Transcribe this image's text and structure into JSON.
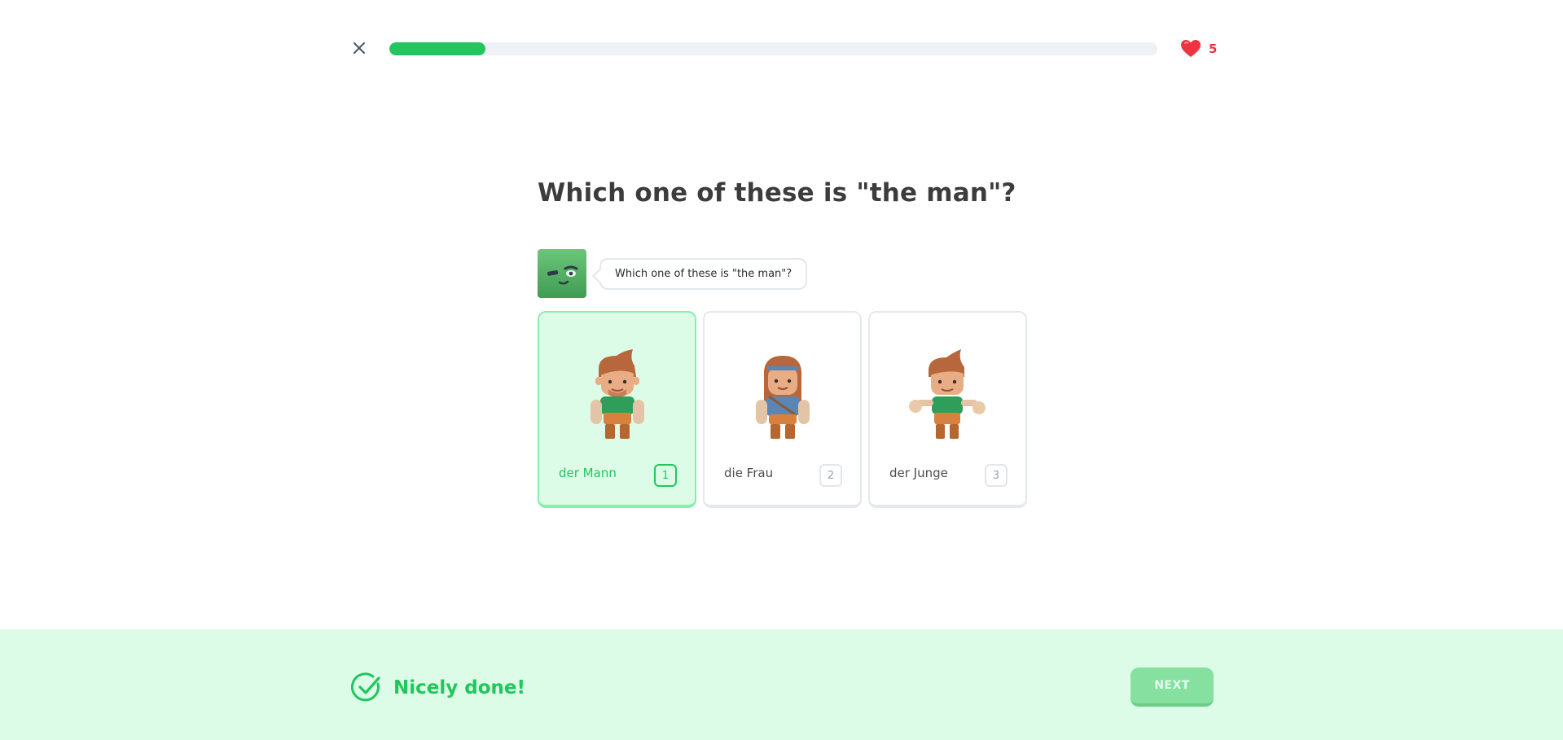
{
  "header": {
    "close_icon": "close-icon",
    "progress_fraction": 0.125,
    "progress_color": "#22c55e",
    "hearts_icon": "heart-icon",
    "hearts_count": "5"
  },
  "question": {
    "title": "Which one of these is \"the man\"?",
    "speech": "Which one of these is \"the man\"?"
  },
  "choices": [
    {
      "label": "der Mann",
      "key": "1",
      "selected": true
    },
    {
      "label": "die Frau",
      "key": "2",
      "selected": false
    },
    {
      "label": "der Junge",
      "key": "3",
      "selected": false
    }
  ],
  "footer": {
    "result_icon": "check-circle-icon",
    "result_text": "Nicely done!",
    "next_label": "NEXT"
  },
  "colors": {
    "accent": "#22c55e",
    "success_bg": "#dcfce7",
    "heart": "#ef3340"
  }
}
